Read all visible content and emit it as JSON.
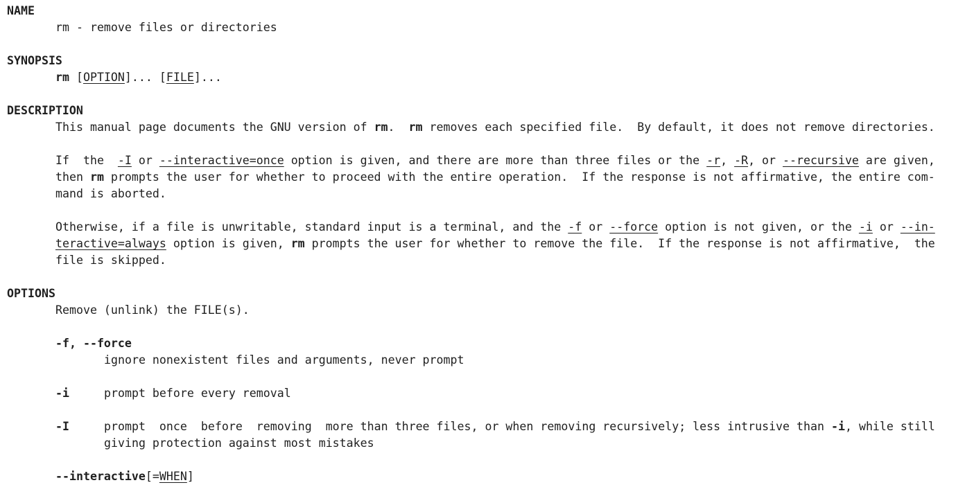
{
  "man_page": {
    "name_section": {
      "heading": "NAME",
      "line": "rm - remove files or directories"
    },
    "synopsis_section": {
      "heading": "SYNOPSIS",
      "command": "rm",
      "open1": " [",
      "option_arg": "OPTION",
      "mid": "]... [",
      "file_arg": "FILE",
      "close": "]..."
    },
    "description_section": {
      "heading": "DESCRIPTION",
      "p1": {
        "a": "This manual page documents the GNU version of ",
        "rm1": "rm",
        "b": ".  ",
        "rm2": "rm",
        "c": " removes each specified file.  By default, it does not remove directories."
      },
      "p2": {
        "a": "If  the  ",
        "opt_I": "-I",
        "b": " or ",
        "opt_interactive_once": "--interactive=once",
        "c": " option is given, and there are more than three files or the ",
        "opt_r": "-r",
        "d": ", ",
        "opt_R": "-R",
        "e": ", or ",
        "opt_recursive": "--recursive",
        "f": " are given,",
        "l2a": "then ",
        "rm": "rm",
        "l2b": " prompts the user for whether to proceed with the entire operation.  If the response is not affirmative, the entire com-",
        "l3": "mand is aborted."
      },
      "p3": {
        "a": "Otherwise, if a file is unwritable, standard input is a terminal, and the ",
        "opt_f": "-f",
        "b": " or ",
        "opt_force": "--force",
        "c": " option is not given, or the ",
        "opt_i": "-i",
        "d": " or ",
        "opt_in": "--in-",
        "l2_opt": "teractive=always",
        "l2a": " option is given, ",
        "rm": "rm",
        "l2b": " prompts the user for whether to remove the file.  If the response is not affirmative,  the",
        "l3": "file is skipped."
      }
    },
    "options_section": {
      "heading": "OPTIONS",
      "intro": "Remove (unlink) the FILE(s).",
      "force": {
        "flag": "-f, --force",
        "desc": "ignore nonexistent files and arguments, never prompt"
      },
      "i": {
        "flag": "-i",
        "desc": "prompt before every removal"
      },
      "I": {
        "flag": "-I",
        "desc_a": "prompt  once  before  removing  more than three files, or when removing recursively; less intrusive than ",
        "desc_flag": "-i",
        "desc_b": ", while still",
        "desc_l2": "giving protection against most mistakes"
      },
      "interactive": {
        "flag": "--interactive",
        "bracket": "[=",
        "when": "WHEN",
        "close": "]"
      }
    }
  }
}
